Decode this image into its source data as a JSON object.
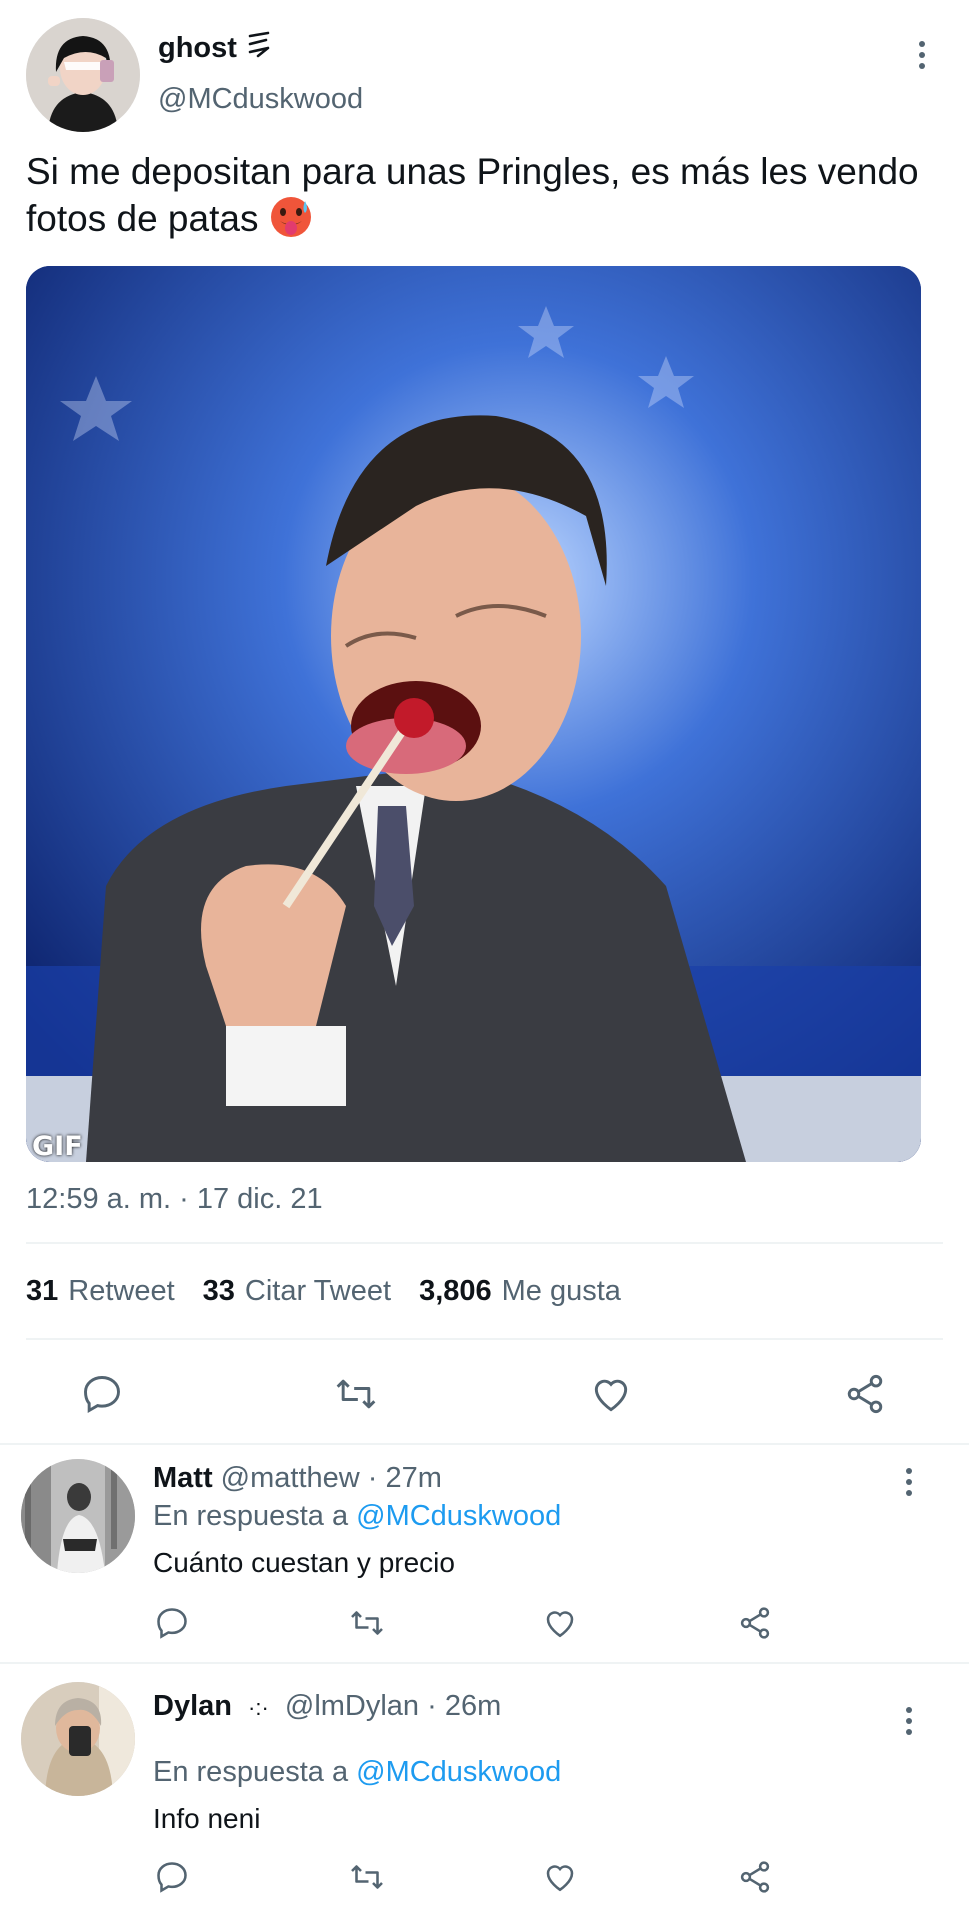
{
  "tweet": {
    "author_name": "ghost",
    "author_badge": "⚞",
    "author_handle": "@MCduskwood",
    "text": "Si me depositan para unas Pringles, es más les vendo fotos de patas",
    "media_badge": "GIF",
    "timestamp": "12:59 a. m. · 17 dic. 21",
    "stats": {
      "retweets_count": "31",
      "retweets_label": "Retweet",
      "quotes_count": "33",
      "quotes_label": "Citar Tweet",
      "likes_count": "3,806",
      "likes_label": "Me gusta"
    }
  },
  "replies": [
    {
      "name": "Matt",
      "handle_time": "@matthew · 27m",
      "reply_prefix": "En respuesta a",
      "reply_mention": "@MCduskwood",
      "text": "Cuánto cuestan y precio"
    },
    {
      "name": "Dylan",
      "badge": "·:·",
      "handle_time": "@lmDylan · 26m",
      "reply_prefix": "En respuesta a",
      "reply_mention": "@MCduskwood",
      "text": "Info neni"
    }
  ],
  "icons": [
    "reply-icon",
    "retweet-icon",
    "like-icon",
    "share-icon",
    "more-icon",
    "hot-face-emoji"
  ],
  "colors": {
    "text": "#0f1419",
    "secondary": "#536471",
    "link": "#1d9bf0",
    "divider": "#eff3f4"
  }
}
